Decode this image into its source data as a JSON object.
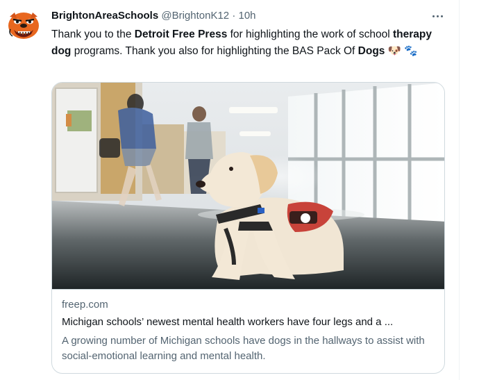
{
  "tweet": {
    "display_name": "BrightonAreaSchools",
    "handle": "@BrightonK12",
    "separator": "·",
    "time": "10h",
    "text_parts": {
      "p1": "Thank you to the ",
      "p2": "Detroit Free Press",
      "p3": " for highlighting the work of school ",
      "p4": "therapy dog",
      "p5": " programs.  Thank you also for highlighting the BAS Pack Of ",
      "p6": "Dogs",
      "emoji1": "🐶",
      "emoji2": "🐾"
    }
  },
  "card": {
    "domain": "freep.com",
    "headline": "Michigan schools’ newest mental health workers have four legs and a ...",
    "description": "A growing number of Michigan schools have dogs in the hallways to assist with social-emotional learning and mental health."
  },
  "colors": {
    "text": "#0f1419",
    "secondary": "#536471",
    "border": "#cfd9de",
    "avatar_orange": "#e8671f"
  }
}
